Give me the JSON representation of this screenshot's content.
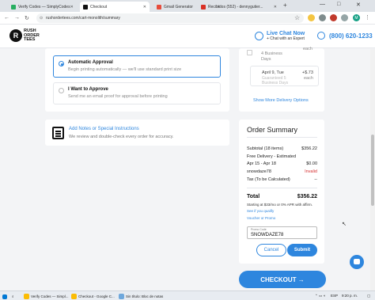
{
  "browser": {
    "tabs": [
      {
        "label": "Verify Codes — SimplyCodes",
        "active": false
      },
      {
        "label": "Checkout",
        "active": true
      },
      {
        "label": "Gmail Generator",
        "active": false
      },
      {
        "label": "Recibidos (552) - dennygutier...",
        "active": false
      }
    ],
    "url": "rushordertees.com/cart-monolith/summary"
  },
  "header": {
    "logo_mark": "R",
    "logo_lines": [
      "RUSH",
      "ORDER",
      "TEES"
    ],
    "chat_title": "Live Chat Now",
    "chat_sub": "+ Chat with an Expert",
    "phone": "(800) 620-1233"
  },
  "approval": {
    "auto_title": "Automatic Approval",
    "auto_desc": "Begin printing automatically — we'll use standard print size",
    "manual_title": "I Want to Approve",
    "manual_desc": "Send me an email proof for approval before printing"
  },
  "notes": {
    "link": "Add Notes or Special Instructions",
    "desc": "We review and double-check every order for accuracy."
  },
  "delivery": {
    "row1_days": "4 Business Days",
    "row1_price": "each",
    "row2_date": "April 9, Tue",
    "row2_sub": "Guaranteed 5 Business Days",
    "row2_price": "+$.73",
    "row2_each": "each",
    "more_link": "Show More Delivery Options"
  },
  "summary": {
    "title": "Order Summary",
    "rows": [
      {
        "label": "Subtotal (18 items)",
        "value": "$356.22"
      },
      {
        "label": "Free Delivery - Estimated",
        "value": ""
      },
      {
        "label": "Apr 15 - Apr 18",
        "value": "$0.00"
      },
      {
        "label": "snowdaze78",
        "value": "Invalid",
        "red": true
      },
      {
        "label": "Tax (To be Calculated)",
        "value": "--"
      }
    ],
    "total_label": "Total",
    "total_value": "$356.22",
    "affirm_text": "Starting at $33/mo or 0% APR with affirm.",
    "affirm_link": "See if you qualify",
    "voucher_link": "Voucher or Promo",
    "promo_label": "Promo Code",
    "promo_value": "SNOWDAZE78",
    "cancel": "Cancel",
    "submit": "Submit",
    "checkout": "CHECKOUT →"
  },
  "taskbar": {
    "items": [
      "Verify Codes — Simpl...",
      "Checkout - Google C...",
      "Sin título: Bloc de notas"
    ],
    "lang": "ESP",
    "time": "9:20 p. m."
  },
  "colors": {
    "accent": "#2e86de",
    "invalid": "#d63031"
  }
}
